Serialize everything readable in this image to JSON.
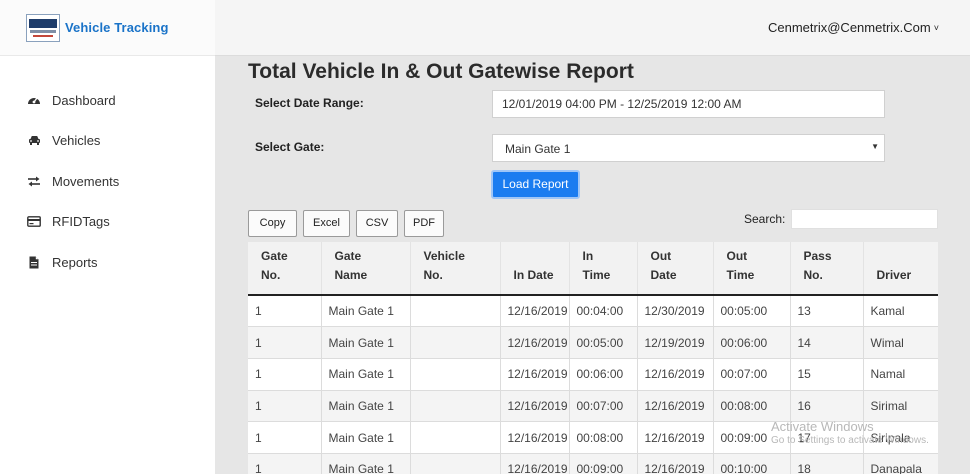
{
  "app": {
    "brand_name": "Vehicle Tracking"
  },
  "user": {
    "email": "Cenmetrix@Cenmetrix.Com",
    "caret": "˅"
  },
  "sidebar": {
    "items": [
      {
        "label": "Dashboard",
        "icon": "dashboard-gauge-icon"
      },
      {
        "label": "Vehicles",
        "icon": "car-icon"
      },
      {
        "label": "Movements",
        "icon": "exchange-arrows-icon"
      },
      {
        "label": "RFIDTags",
        "icon": "card-icon"
      },
      {
        "label": "Reports",
        "icon": "file-icon"
      }
    ]
  },
  "page": {
    "title": "Total Vehicle In & Out Gatewise Report",
    "date_range_label": "Select Date Range:",
    "date_range_value": "12/01/2019 04:00 PM - 12/25/2019 12:00 AM",
    "gate_label": "Select Gate:",
    "gate_value": "Main Gate 1",
    "load_button": "Load Report"
  },
  "toolbar": {
    "copy": "Copy",
    "excel": "Excel",
    "csv": "CSV",
    "pdf": "PDF",
    "search_label": "Search:",
    "search_value": ""
  },
  "table": {
    "headers": [
      [
        "Gate",
        "No."
      ],
      [
        "Gate",
        "Name"
      ],
      [
        "Vehicle",
        "No."
      ],
      [
        "In Date",
        ""
      ],
      [
        "In",
        "Time"
      ],
      [
        "Out",
        "Date"
      ],
      [
        "Out",
        "Time"
      ],
      [
        "Pass",
        "No."
      ],
      [
        "Driver",
        ""
      ]
    ],
    "rows": [
      [
        "1",
        "Main Gate 1",
        "",
        "12/16/2019",
        "00:04:00",
        "12/30/2019",
        "00:05:00",
        "13",
        "Kamal"
      ],
      [
        "1",
        "Main Gate 1",
        "",
        "12/16/2019",
        "00:05:00",
        "12/19/2019",
        "00:06:00",
        "14",
        "Wimal"
      ],
      [
        "1",
        "Main Gate 1",
        "",
        "12/16/2019",
        "00:06:00",
        "12/16/2019",
        "00:07:00",
        "15",
        "Namal"
      ],
      [
        "1",
        "Main Gate 1",
        "",
        "12/16/2019",
        "00:07:00",
        "12/16/2019",
        "00:08:00",
        "16",
        "Sirimal"
      ],
      [
        "1",
        "Main Gate 1",
        "",
        "12/16/2019",
        "00:08:00",
        "12/16/2019",
        "00:09:00",
        "17",
        "Siripala"
      ],
      [
        "1",
        "Main Gate 1",
        "",
        "12/16/2019",
        "00:09:00",
        "12/16/2019",
        "00:10:00",
        "18",
        "Danapala"
      ]
    ]
  },
  "watermark": {
    "line1": "Activate Windows",
    "line2": "Go to Settings to activate Windows."
  },
  "colors": {
    "accent": "#1a7cf0",
    "brand_text": "#1a73c8",
    "sidebar_bg": "#ffffff",
    "content_bg": "#e6e6e6"
  }
}
